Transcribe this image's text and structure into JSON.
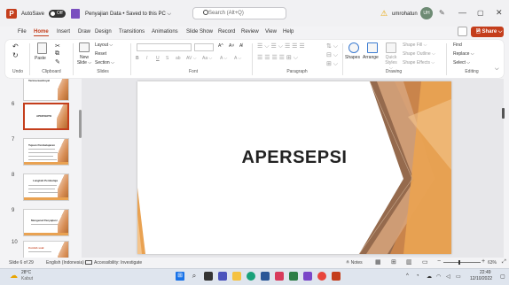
{
  "titlebar": {
    "app_logo": "P",
    "autosave_label": "AutoSave",
    "autosave_state": "Off",
    "document_title": "Penyajian Data • Saved to this PC ⌵",
    "search_placeholder": "Search (Alt+Q)",
    "user_name": "umrohatun",
    "avatar_initials": "UH",
    "min_glyph": "—",
    "max_glyph": "▢",
    "close_glyph": "✕",
    "warning_icon": "warning-icon",
    "pen_glyph": "✎"
  },
  "tabs": [
    "File",
    "Home",
    "Insert",
    "Draw",
    "Design",
    "Transitions",
    "Animations",
    "Slide Show",
    "Record",
    "Review",
    "View",
    "Help"
  ],
  "active_tab": "Home",
  "share_label": "🖻 Share ⌵",
  "ribbon": {
    "undo_group": "Undo",
    "clipboard_group": "Clipboard",
    "paste_label": "Paste",
    "slides_group": "Slides",
    "new_slide_label": "New Slide ⌵",
    "layout_label": "Layout ⌵",
    "reset_label": "Reset",
    "section_label": "Section ⌵",
    "font_group": "Font",
    "font_buttons": [
      "B",
      "I",
      "U",
      "S",
      "ab",
      "AV ⌵",
      "Aa ⌵",
      "A ⌵",
      "A ⌵"
    ],
    "font_size_buttons": [
      "A^",
      "A˅",
      "A̸"
    ],
    "paragraph_group": "Paragraph",
    "drawing_group": "Drawing",
    "shapes_label": "Shapes",
    "arrange_label": "Arrange",
    "quick_styles_label": "Quick Styles ⌵",
    "shape_fill_label": "Shape Fill ⌵",
    "shape_outline_label": "Shape Outline ⌵",
    "shape_effects_label": "Shape Effects ⌵",
    "editing_group": "Editing",
    "find_label": "Find",
    "replace_label": "Replace ⌵",
    "select_label": "Select ⌵"
  },
  "thumbnails": [
    {
      "number": "",
      "title": "Terima kasihnya!",
      "selected": false
    },
    {
      "number": "6",
      "title": "APERSEPSI",
      "selected": true
    },
    {
      "number": "7",
      "title": "Tujuan Pembelajaran",
      "selected": false
    },
    {
      "number": "8",
      "title": "Langkah Pembelajaran",
      "selected": false
    },
    {
      "number": "9",
      "title": "Mengenal Penyajian Data",
      "selected": false
    },
    {
      "number": "10",
      "title": "Contoh soal",
      "selected": false
    }
  ],
  "slide": {
    "title": "APERSEPSI",
    "accent_colors": [
      "#e9a252",
      "#c9844b",
      "#8a5a3a",
      "#f4c48c"
    ]
  },
  "status": {
    "slide_info": "Slide 6 of 29",
    "language": "English (Indonesia)",
    "accessibility": "Accessibility: Investigate",
    "notes_label": "≙ Notes",
    "zoom": "63%"
  },
  "taskbar": {
    "weather_temp": "28°C",
    "weather_text": "Kabut",
    "tray_time": "22:49",
    "tray_date": "12/10/2022"
  },
  "colors": {
    "accent": "#c43e1c",
    "orange": "#e9a252"
  }
}
